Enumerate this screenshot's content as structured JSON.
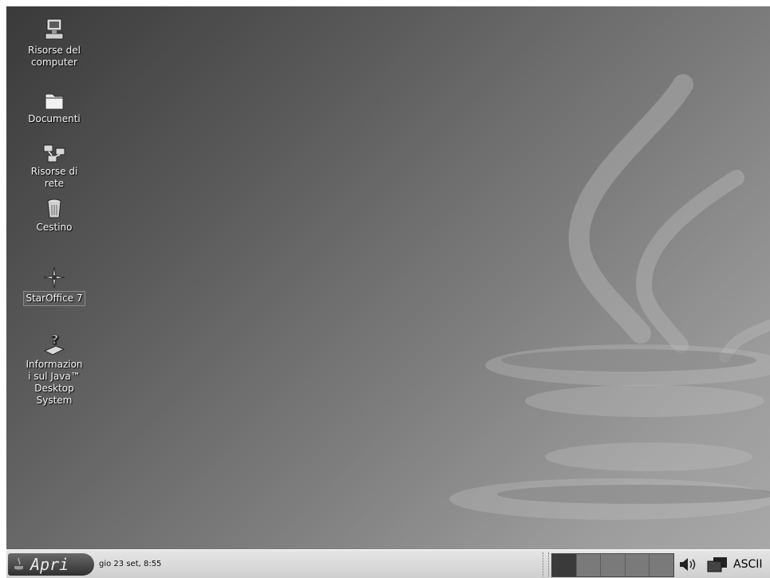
{
  "desktop": {
    "icons": [
      {
        "label": "Risorse del\ncomputer",
        "icon": "computer-icon"
      },
      {
        "label": "Documenti",
        "icon": "folder-icon"
      },
      {
        "label": "Risorse di\nrete",
        "icon": "network-places-icon"
      },
      {
        "label": "Cestino",
        "icon": "trash-icon"
      },
      {
        "label": "StarOffice 7",
        "icon": "staroffice-icon"
      },
      {
        "label": "Informazion\ni sul Java™\nDesktop\nSystem",
        "icon": "help-icon"
      }
    ]
  },
  "taskbar": {
    "start_label": "Apri",
    "clock": "gio 23 set,  8:55",
    "workspaces": 5,
    "active_workspace": 1,
    "tray_text": "ASCII"
  }
}
